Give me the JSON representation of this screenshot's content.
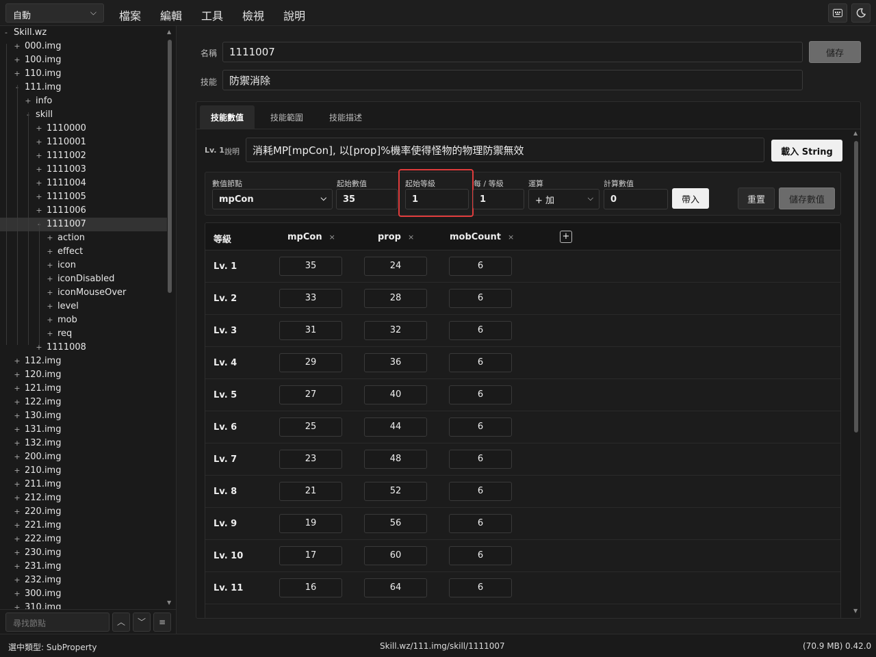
{
  "topbar": {
    "mode": "自動",
    "menu": [
      "檔案",
      "編輯",
      "工具",
      "檢視",
      "說明"
    ],
    "icons": [
      "keyboard-icon",
      "moon-icon"
    ]
  },
  "tree": {
    "items": [
      {
        "depth": 0,
        "toggle": "-",
        "label": "Skill.wz"
      },
      {
        "depth": 1,
        "toggle": "+",
        "label": "000.img"
      },
      {
        "depth": 1,
        "toggle": "+",
        "label": "100.img"
      },
      {
        "depth": 1,
        "toggle": "+",
        "label": "110.img"
      },
      {
        "depth": 1,
        "toggle": "-",
        "label": "111.img"
      },
      {
        "depth": 2,
        "toggle": "+",
        "label": "info"
      },
      {
        "depth": 2,
        "toggle": "-",
        "label": "skill"
      },
      {
        "depth": 3,
        "toggle": "+",
        "label": "1110000"
      },
      {
        "depth": 3,
        "toggle": "+",
        "label": "1110001"
      },
      {
        "depth": 3,
        "toggle": "+",
        "label": "1111002"
      },
      {
        "depth": 3,
        "toggle": "+",
        "label": "1111003"
      },
      {
        "depth": 3,
        "toggle": "+",
        "label": "1111004"
      },
      {
        "depth": 3,
        "toggle": "+",
        "label": "1111005"
      },
      {
        "depth": 3,
        "toggle": "+",
        "label": "1111006"
      },
      {
        "depth": 3,
        "toggle": "-",
        "label": "1111007",
        "selected": true
      },
      {
        "depth": 4,
        "toggle": "+",
        "label": "action"
      },
      {
        "depth": 4,
        "toggle": "+",
        "label": "effect"
      },
      {
        "depth": 4,
        "toggle": "+",
        "label": "icon"
      },
      {
        "depth": 4,
        "toggle": "+",
        "label": "iconDisabled"
      },
      {
        "depth": 4,
        "toggle": "+",
        "label": "iconMouseOver"
      },
      {
        "depth": 4,
        "toggle": "+",
        "label": "level"
      },
      {
        "depth": 4,
        "toggle": "+",
        "label": "mob"
      },
      {
        "depth": 4,
        "toggle": "+",
        "label": "req"
      },
      {
        "depth": 3,
        "toggle": "+",
        "label": "1111008"
      },
      {
        "depth": 1,
        "toggle": "+",
        "label": "112.img"
      },
      {
        "depth": 1,
        "toggle": "+",
        "label": "120.img"
      },
      {
        "depth": 1,
        "toggle": "+",
        "label": "121.img"
      },
      {
        "depth": 1,
        "toggle": "+",
        "label": "122.img"
      },
      {
        "depth": 1,
        "toggle": "+",
        "label": "130.img"
      },
      {
        "depth": 1,
        "toggle": "+",
        "label": "131.img"
      },
      {
        "depth": 1,
        "toggle": "+",
        "label": "132.img"
      },
      {
        "depth": 1,
        "toggle": "+",
        "label": "200.img"
      },
      {
        "depth": 1,
        "toggle": "+",
        "label": "210.img"
      },
      {
        "depth": 1,
        "toggle": "+",
        "label": "211.img"
      },
      {
        "depth": 1,
        "toggle": "+",
        "label": "212.img"
      },
      {
        "depth": 1,
        "toggle": "+",
        "label": "220.img"
      },
      {
        "depth": 1,
        "toggle": "+",
        "label": "221.img"
      },
      {
        "depth": 1,
        "toggle": "+",
        "label": "222.img"
      },
      {
        "depth": 1,
        "toggle": "+",
        "label": "230.img"
      },
      {
        "depth": 1,
        "toggle": "+",
        "label": "231.img"
      },
      {
        "depth": 1,
        "toggle": "+",
        "label": "232.img"
      },
      {
        "depth": 1,
        "toggle": "+",
        "label": "300.img"
      },
      {
        "depth": 1,
        "toggle": "+",
        "label": "310.img"
      }
    ]
  },
  "search": {
    "placeholder": "尋找節點",
    "up": "︿",
    "down": "﹀",
    "menu": "≡"
  },
  "status": {
    "type": "選中類型: SubProperty",
    "path": "Skill.wz/111.img/skill/1111007",
    "size": "(70.9 MB)",
    "version": "0.42.0"
  },
  "form": {
    "name_label": "名稱",
    "name_value": "1111007",
    "save_label": "儲存",
    "skill_label": "技能",
    "skill_value": "防禦消除"
  },
  "tabs": [
    "技能數值",
    "技能範圍",
    "技能描述"
  ],
  "desc": {
    "level": "Lv. 1",
    "label": "說明",
    "text": "消耗MP[mpCon], 以[prop]%機率使得怪物的物理防禦無效",
    "load_button": "載入 String"
  },
  "calc": {
    "node_label": "數值節點",
    "node_value": "mpCon",
    "start_value_label": "起始數值",
    "start_value": "35",
    "start_level_label": "起始等級",
    "start_level": "1",
    "per_level_label": "每 / 等級",
    "per_level": "1",
    "op_label": "運算",
    "op_value": "+ 加",
    "result_label": "計算數值",
    "result_value": "0",
    "apply_button": "帶入",
    "reset_button": "重置",
    "save_button": "儲存數值"
  },
  "table": {
    "columns": [
      "等級",
      "mpCon",
      "prop",
      "mobCount"
    ],
    "remove_symbol": "×",
    "add_symbol": "+",
    "rows": [
      {
        "level": "Lv. 1",
        "values": [
          "35",
          "24",
          "6"
        ]
      },
      {
        "level": "Lv. 2",
        "values": [
          "33",
          "28",
          "6"
        ]
      },
      {
        "level": "Lv. 3",
        "values": [
          "31",
          "32",
          "6"
        ]
      },
      {
        "level": "Lv. 4",
        "values": [
          "29",
          "36",
          "6"
        ]
      },
      {
        "level": "Lv. 5",
        "values": [
          "27",
          "40",
          "6"
        ]
      },
      {
        "level": "Lv. 6",
        "values": [
          "25",
          "44",
          "6"
        ]
      },
      {
        "level": "Lv. 7",
        "values": [
          "23",
          "48",
          "6"
        ]
      },
      {
        "level": "Lv. 8",
        "values": [
          "21",
          "52",
          "6"
        ]
      },
      {
        "level": "Lv. 9",
        "values": [
          "19",
          "56",
          "6"
        ]
      },
      {
        "level": "Lv. 10",
        "values": [
          "17",
          "60",
          "6"
        ]
      },
      {
        "level": "Lv. 11",
        "values": [
          "16",
          "64",
          "6"
        ]
      }
    ]
  },
  "colors": {
    "highlight": "#e03c3c",
    "accent": "#f0f0f0"
  }
}
